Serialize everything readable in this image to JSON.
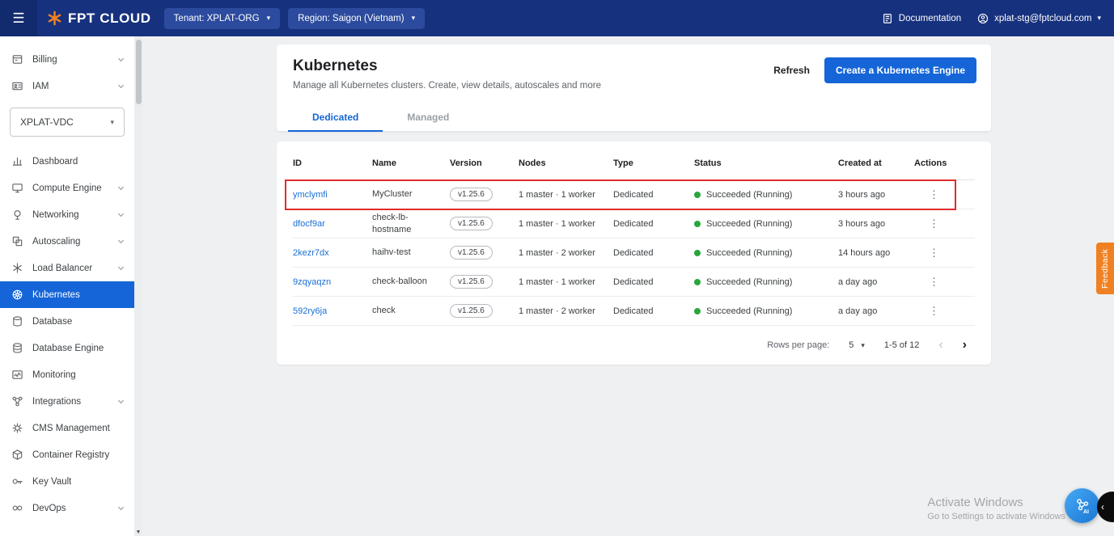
{
  "icons": {
    "menu": "☰",
    "caret_down": "▾",
    "more_vertical": "⋮",
    "prev_page": "‹",
    "next_page": "›",
    "scroll_down_arrow": "▼",
    "collapse": "‹"
  },
  "colors": {
    "topbar_blue": "#16317e",
    "accent_blue": "#1565d8",
    "link_blue": "#1a6fd4",
    "status_green": "#27a73c",
    "feedback_orange": "#f08123",
    "highlight_red": "#e02b2b"
  },
  "topbar": {
    "brand": "FPT CLOUD",
    "tenant_label": "Tenant: XPLAT-ORG",
    "region_label": "Region: Saigon (Vietnam)",
    "documentation_label": "Documentation",
    "account_email": "xplat-stg@fptcloud.com"
  },
  "sidebar": {
    "billing_label": "Billing",
    "iam_label": "IAM",
    "vdc_selected": "XPLAT-VDC",
    "items": [
      {
        "label": "Dashboard"
      },
      {
        "label": "Compute Engine"
      },
      {
        "label": "Networking"
      },
      {
        "label": "Autoscaling"
      },
      {
        "label": "Load Balancer"
      },
      {
        "label": "Kubernetes",
        "active": true
      },
      {
        "label": "Database"
      },
      {
        "label": "Database Engine"
      },
      {
        "label": "Monitoring"
      },
      {
        "label": "Integrations"
      },
      {
        "label": "CMS Management"
      },
      {
        "label": "Container Registry"
      },
      {
        "label": "Key Vault"
      },
      {
        "label": "DevOps"
      }
    ]
  },
  "main": {
    "title": "Kubernetes",
    "subtitle": "Manage all Kubernetes clusters. Create, view details, autoscales and more",
    "refresh_label": "Refresh",
    "create_button_label": "Create a Kubernetes Engine",
    "tabs": [
      {
        "label": "Dedicated",
        "active": true
      },
      {
        "label": "Managed",
        "active": false
      }
    ],
    "table": {
      "headers": [
        "ID",
        "Name",
        "Version",
        "Nodes",
        "Type",
        "Status",
        "Created at",
        "Actions"
      ],
      "rows": [
        {
          "id": "ymclymfi",
          "name": "MyCluster",
          "version": "v1.25.6",
          "nodes": "1 master · 1 worker",
          "type": "Dedicated",
          "status": "Succeeded (Running)",
          "created": "3 hours ago",
          "highlighted": true
        },
        {
          "id": "dfocf9ar",
          "name": "check-lb-hostname",
          "version": "v1.25.6",
          "nodes": "1 master · 1 worker",
          "type": "Dedicated",
          "status": "Succeeded (Running)",
          "created": "3 hours ago",
          "highlighted": false
        },
        {
          "id": "2kezr7dx",
          "name": "haihv-test",
          "version": "v1.25.6",
          "nodes": "1 master · 2 worker",
          "type": "Dedicated",
          "status": "Succeeded (Running)",
          "created": "14 hours ago",
          "highlighted": false
        },
        {
          "id": "9zqyaqzn",
          "name": "check-balloon",
          "version": "v1.25.6",
          "nodes": "1 master · 1 worker",
          "type": "Dedicated",
          "status": "Succeeded (Running)",
          "created": "a day ago",
          "highlighted": false
        },
        {
          "id": "592ry6ja",
          "name": "check",
          "version": "v1.25.6",
          "nodes": "1 master · 2 worker",
          "type": "Dedicated",
          "status": "Succeeded (Running)",
          "created": "a day ago",
          "highlighted": false
        }
      ]
    },
    "pagination": {
      "rows_per_page_label": "Rows per page:",
      "rows_per_page_value": "5",
      "range_label": "1-5 of 12"
    }
  },
  "feedback_label": "Feedback",
  "watermark": {
    "line1": "Activate Windows",
    "line2": "Go to Settings to activate Windows"
  },
  "assistant_button_label": "AI"
}
